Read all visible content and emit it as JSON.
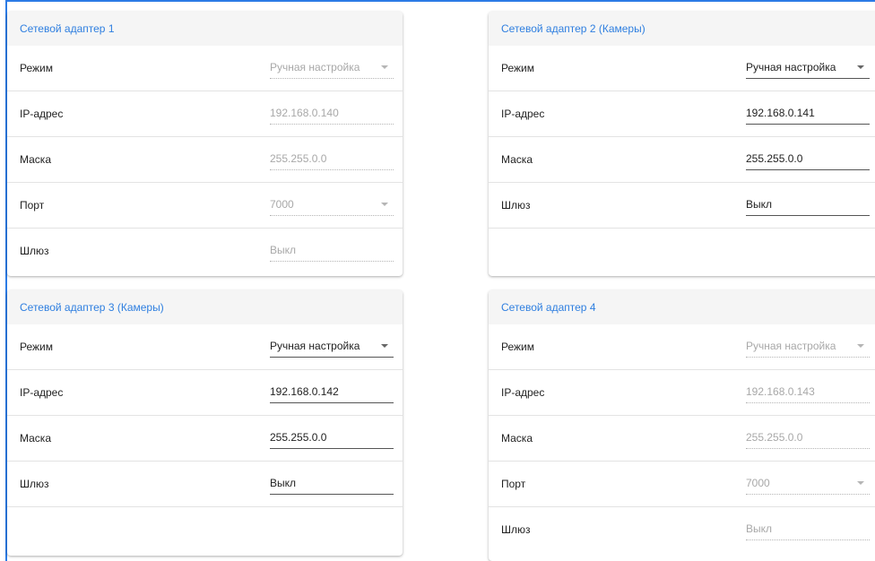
{
  "adapters": [
    {
      "title": "Сетевой адаптер 1",
      "enabled": false,
      "rows": [
        {
          "label": "Режим",
          "value": "Ручная настройка",
          "dropdown": true
        },
        {
          "label": "IP-адрес",
          "value": "192.168.0.140",
          "dropdown": false
        },
        {
          "label": "Маска",
          "value": "255.255.0.0",
          "dropdown": false
        },
        {
          "label": "Порт",
          "value": "7000",
          "dropdown": true
        },
        {
          "label": "Шлюз",
          "value": "Выкл",
          "dropdown": false
        }
      ]
    },
    {
      "title": "Сетевой адаптер 2 (Камеры)",
      "enabled": true,
      "rows": [
        {
          "label": "Режим",
          "value": "Ручная настройка",
          "dropdown": true
        },
        {
          "label": "IP-адрес",
          "value": "192.168.0.141",
          "dropdown": false
        },
        {
          "label": "Маска",
          "value": "255.255.0.0",
          "dropdown": false
        },
        {
          "label": "Шлюз",
          "value": "Выкл",
          "dropdown": false
        }
      ]
    },
    {
      "title": "Сетевой адаптер 3 (Камеры)",
      "enabled": true,
      "rows": [
        {
          "label": "Режим",
          "value": "Ручная настройка",
          "dropdown": true
        },
        {
          "label": "IP-адрес",
          "value": "192.168.0.142",
          "dropdown": false
        },
        {
          "label": "Маска",
          "value": "255.255.0.0",
          "dropdown": false
        },
        {
          "label": "Шлюз",
          "value": "Выкл",
          "dropdown": false
        }
      ]
    },
    {
      "title": "Сетевой адаптер 4",
      "enabled": false,
      "rows": [
        {
          "label": "Режим",
          "value": "Ручная настройка",
          "dropdown": true
        },
        {
          "label": "IP-адрес",
          "value": "192.168.0.143",
          "dropdown": false
        },
        {
          "label": "Маска",
          "value": "255.255.0.0",
          "dropdown": false
        },
        {
          "label": "Порт",
          "value": "7000",
          "dropdown": true
        },
        {
          "label": "Шлюз",
          "value": "Выкл",
          "dropdown": false
        }
      ]
    }
  ],
  "colors": {
    "header_text": "#2f7fe0",
    "header_bg": "#f5f5f5",
    "frame_edge": "#2c7be5",
    "disabled_text": "#a8a8a8"
  }
}
